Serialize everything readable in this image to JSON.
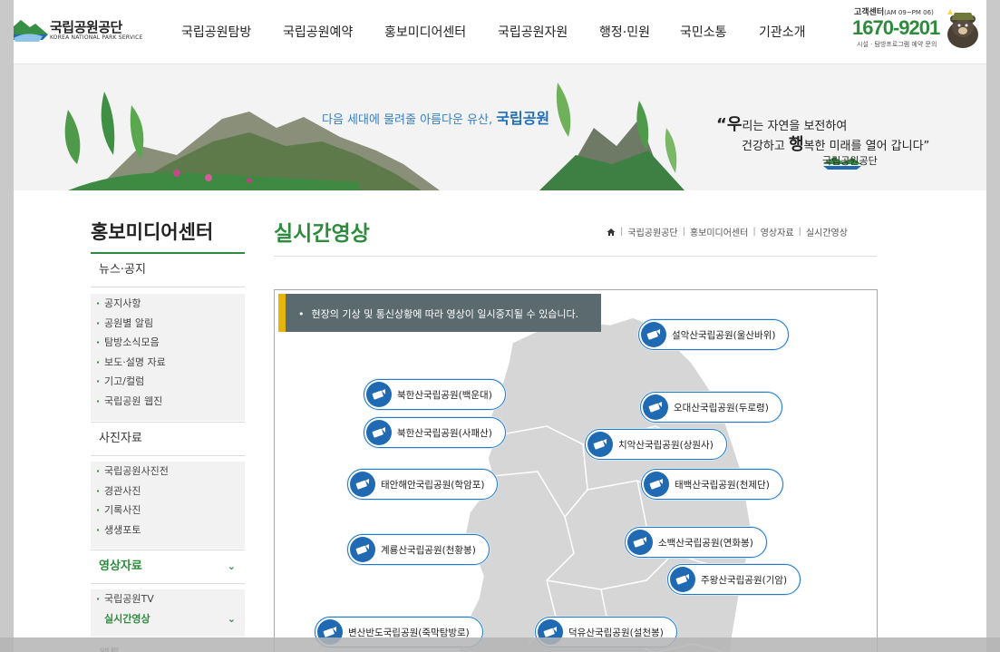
{
  "header": {
    "logo_title": "국립공원공단",
    "logo_sub": "KOREA NATIONAL PARK SERVICE",
    "gnb": [
      "국립공원탐방",
      "국립공원예약",
      "홍보미디어센터",
      "국립공원자원",
      "행정·민원",
      "국민소통",
      "기관소개"
    ],
    "cs_label": "고객센터",
    "cs_hours": "(AM 09~PM 06)",
    "cs_phone": "1670-9201",
    "cs_note": "시설 · 탐방프로그램 예약 문의"
  },
  "banner": {
    "slogan_prefix": "다음 세대에 물려줄 아름다운 유산,",
    "slogan_strong": "국립공원",
    "quote_line1_big": "“우",
    "quote_line1_rest": "리는 자연을 보전하여",
    "quote_line2_prefix": "건강하고 ",
    "quote_line2_big": "행",
    "quote_line2_rest": "복한 미래를 열어 갑니다”",
    "logo_text": "국립공원공단"
  },
  "lnb": {
    "title": "홍보미디어센터",
    "categories": [
      {
        "label": "뉴스·공지",
        "items": [
          "공지사항",
          "공원별 알림",
          "탐방소식모음",
          "보도·설명 자료",
          "기고/컬럼",
          "국립공원 웹진"
        ]
      },
      {
        "label": "사진자료",
        "items": [
          "국립공원사진전",
          "경관사진",
          "기록사진",
          "생생포토"
        ]
      },
      {
        "label": "영상자료",
        "items": [
          "국립공원TV",
          "실시간영상"
        ]
      },
      {
        "label": "웹툰"
      }
    ]
  },
  "content": {
    "title": "실시간영상",
    "breadcrumb": [
      "국립공원공단",
      "홍보미디어센터",
      "영상자료",
      "실시간영상"
    ],
    "notice": "현장의 기상 및 통신상황에 따라 영상이 일시중지될 수 있습니다.",
    "cams": [
      "설악산국립공원(울산바위)",
      "북한산국립공원(백운대)",
      "오대산국립공원(두로령)",
      "북한산국립공원(사패산)",
      "치악산국립공원(상원사)",
      "태안해안국립공원(학암포)",
      "태백산국립공원(천제단)",
      "계룡산국립공원(천황봉)",
      "소백산국립공원(연화봉)",
      "주왕산국립공원(기암)",
      "변산반도국립공원(죽막탐방로)",
      "덕유산국립공원(설천봉)"
    ]
  },
  "colors": {
    "accent_green": "#2e8b3d",
    "cam_blue": "#1f6ab3",
    "notice_bg": "#5b6a6f",
    "notice_bar": "#e5b50a"
  }
}
